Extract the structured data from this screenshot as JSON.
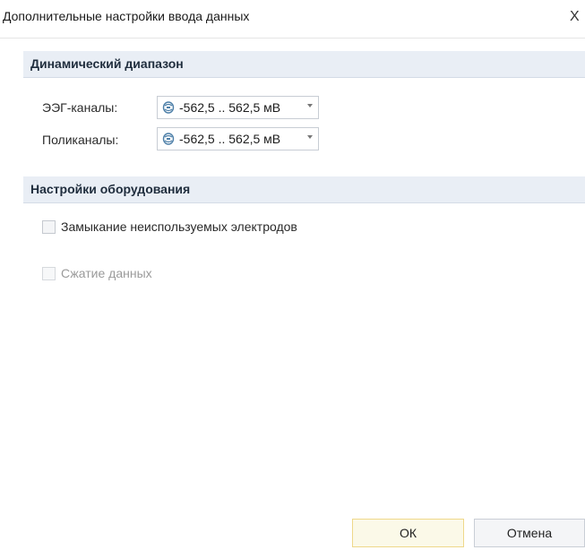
{
  "window": {
    "title": "Дополнительные настройки ввода данных",
    "close_glyph": "X"
  },
  "dynamic_range": {
    "header": "Динамический диапазон",
    "eeg_label": "ЭЭГ-каналы:",
    "eeg_value": "-562,5 .. 562,5 мВ",
    "poly_label": "Поликаналы:",
    "poly_value": "-562,5 .. 562,5 мВ",
    "combo_icon": "range-icon"
  },
  "hardware": {
    "header": "Настройки оборудования",
    "short_unused_label": "Замыкание неиспользуемых электродов",
    "short_unused_checked": false,
    "compression_label": "Сжатие данных",
    "compression_checked": false,
    "compression_enabled": false
  },
  "buttons": {
    "ok_label": "ОК",
    "cancel_label": "Отмена"
  },
  "colors": {
    "section_header_bg": "#e9eef5",
    "ok_button_border": "#efd88a",
    "disabled_text": "#9a9a9a"
  }
}
